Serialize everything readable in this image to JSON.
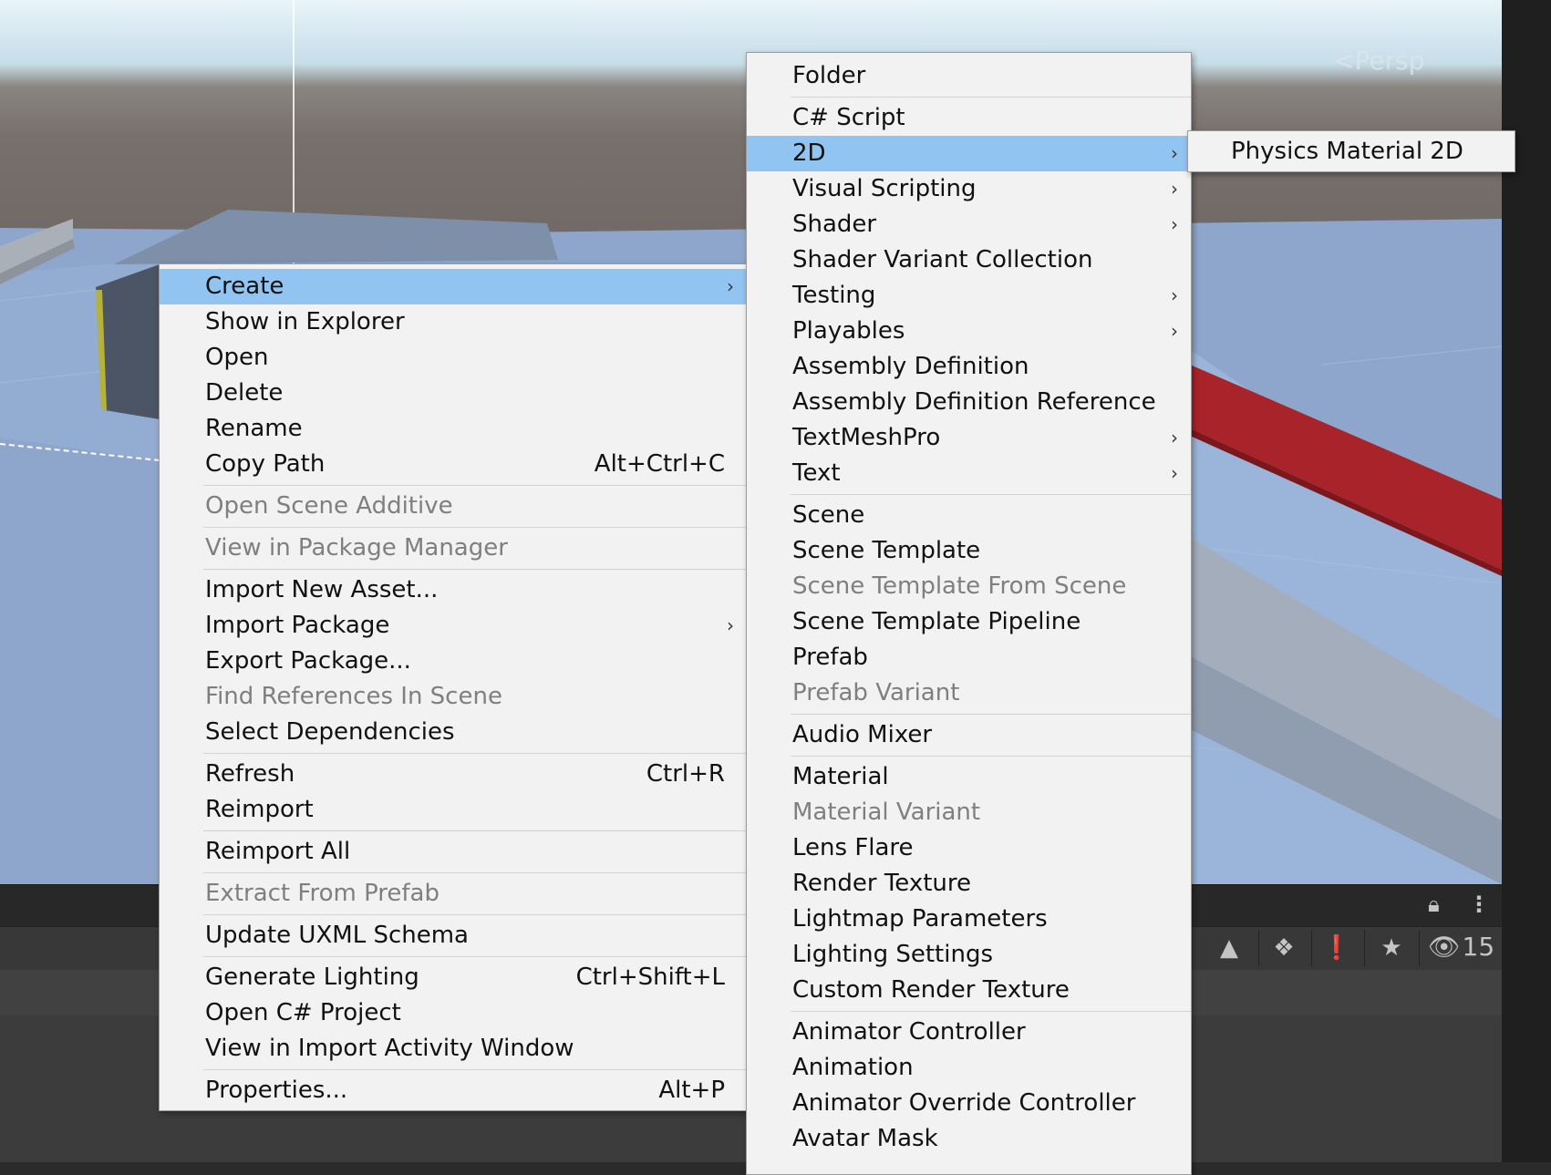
{
  "scene": {
    "view_label": "Persp",
    "colors": {
      "sky": "#e9f4fa",
      "ground": "#98b2d6",
      "red_bar": "#b0252c"
    }
  },
  "bottom_toolbar": {
    "icons": [
      "lock-icon",
      "more-vertical-icon",
      "scene-filter-icon",
      "label-tag-icon",
      "warning-icon",
      "favorite-star-icon",
      "hidden-eye-icon"
    ],
    "hidden_count": "15"
  },
  "context_menu": {
    "items": [
      {
        "label": "Create",
        "state": "selected",
        "submenu": true
      },
      {
        "label": "Show in Explorer"
      },
      {
        "label": "Open"
      },
      {
        "label": "Delete"
      },
      {
        "label": "Rename"
      },
      {
        "label": "Copy Path",
        "shortcut": "Alt+Ctrl+C"
      },
      {
        "sep": true
      },
      {
        "label": "Open Scene Additive",
        "state": "disabled"
      },
      {
        "sep": true
      },
      {
        "label": "View in Package Manager",
        "state": "disabled"
      },
      {
        "sep": true
      },
      {
        "label": "Import New Asset..."
      },
      {
        "label": "Import Package",
        "submenu": true
      },
      {
        "label": "Export Package..."
      },
      {
        "label": "Find References In Scene",
        "state": "disabled"
      },
      {
        "label": "Select Dependencies"
      },
      {
        "sep": true
      },
      {
        "label": "Refresh",
        "shortcut": "Ctrl+R"
      },
      {
        "label": "Reimport"
      },
      {
        "sep": true
      },
      {
        "label": "Reimport All"
      },
      {
        "sep": true
      },
      {
        "label": "Extract From Prefab",
        "state": "disabled"
      },
      {
        "sep": true
      },
      {
        "label": "Update UXML Schema"
      },
      {
        "sep": true
      },
      {
        "label": "Generate Lighting",
        "shortcut": "Ctrl+Shift+L"
      },
      {
        "label": "Open C# Project"
      },
      {
        "label": "View in Import Activity Window"
      },
      {
        "sep": true
      },
      {
        "label": "Properties...",
        "shortcut": "Alt+P"
      }
    ]
  },
  "create_menu": {
    "items": [
      {
        "label": "Folder"
      },
      {
        "sep": true
      },
      {
        "label": "C# Script"
      },
      {
        "label": "2D",
        "state": "selected",
        "submenu": true
      },
      {
        "label": "Visual Scripting",
        "submenu": true
      },
      {
        "label": "Shader",
        "submenu": true
      },
      {
        "label": "Shader Variant Collection"
      },
      {
        "label": "Testing",
        "submenu": true
      },
      {
        "label": "Playables",
        "submenu": true
      },
      {
        "label": "Assembly Definition"
      },
      {
        "label": "Assembly Definition Reference"
      },
      {
        "label": "TextMeshPro",
        "submenu": true
      },
      {
        "label": "Text",
        "submenu": true
      },
      {
        "sep": true
      },
      {
        "label": "Scene"
      },
      {
        "label": "Scene Template"
      },
      {
        "label": "Scene Template From Scene",
        "state": "disabled"
      },
      {
        "label": "Scene Template Pipeline"
      },
      {
        "label": "Prefab"
      },
      {
        "label": "Prefab Variant",
        "state": "disabled"
      },
      {
        "sep": true
      },
      {
        "label": "Audio Mixer"
      },
      {
        "sep": true
      },
      {
        "label": "Material"
      },
      {
        "label": "Material Variant",
        "state": "disabled"
      },
      {
        "label": "Lens Flare"
      },
      {
        "label": "Render Texture"
      },
      {
        "label": "Lightmap Parameters"
      },
      {
        "label": "Lighting Settings"
      },
      {
        "label": "Custom Render Texture"
      },
      {
        "sep": true
      },
      {
        "label": "Animator Controller"
      },
      {
        "label": "Animation"
      },
      {
        "label": "Animator Override Controller"
      },
      {
        "label": "Avatar Mask"
      }
    ]
  },
  "submenu_2d": {
    "items": [
      {
        "label": "Physics Material 2D"
      }
    ]
  },
  "colors": {
    "menu_bg": "#f2f2f2",
    "selection": "#92c4f2",
    "disabled_text": "#7f7f7f"
  }
}
